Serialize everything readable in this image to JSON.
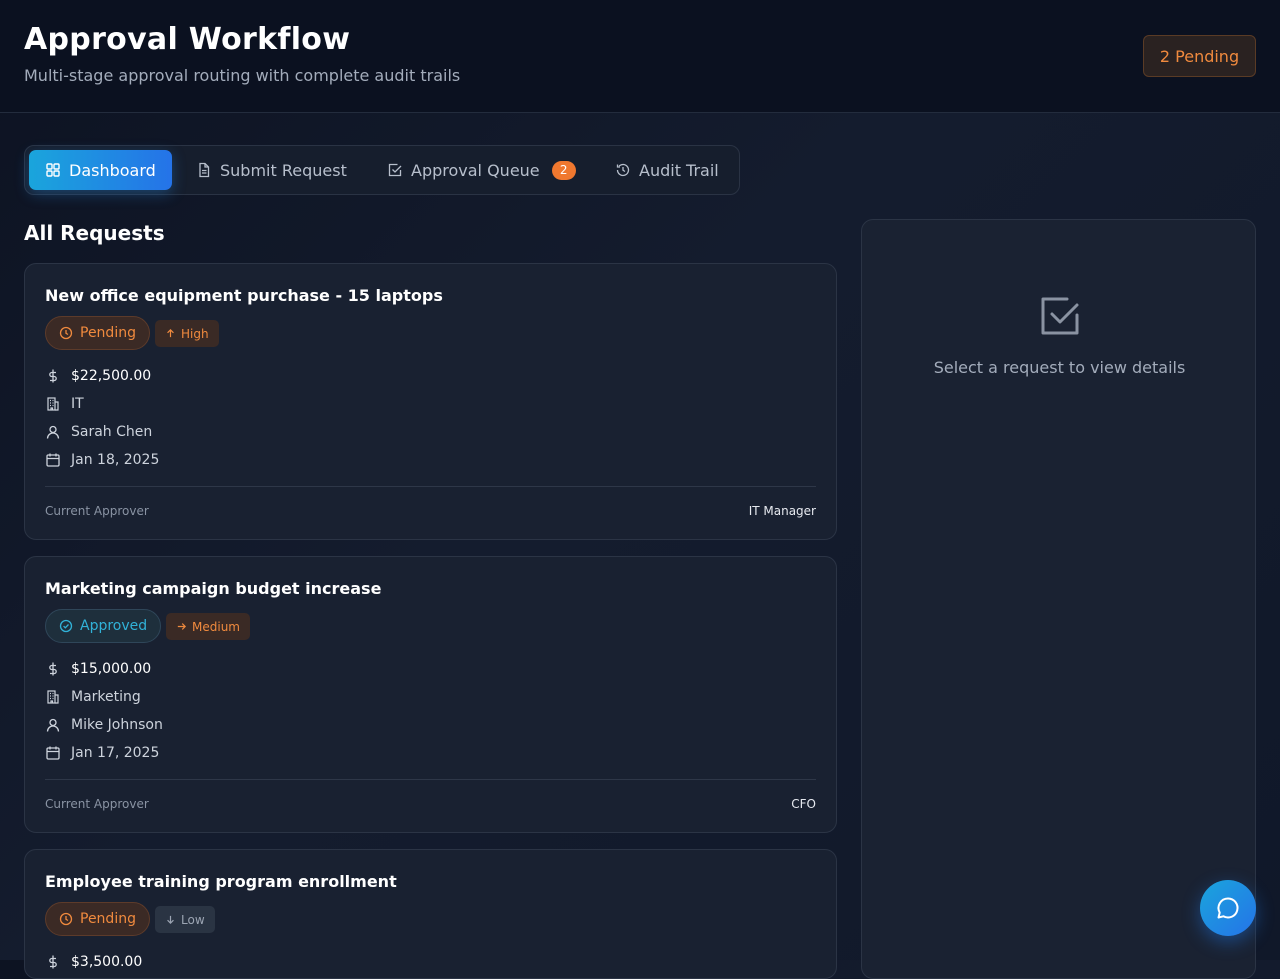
{
  "header": {
    "title": "Approval Workflow",
    "subtitle": "Multi-stage approval routing with complete audit trails",
    "pending_badge": "2 Pending"
  },
  "tabs": [
    {
      "label": "Dashboard",
      "icon": "dashboard-grid-icon",
      "active": true
    },
    {
      "label": "Submit Request",
      "icon": "document-icon",
      "active": false
    },
    {
      "label": "Approval Queue",
      "icon": "check-square-icon",
      "active": false,
      "count": "2"
    },
    {
      "label": "Audit Trail",
      "icon": "history-icon",
      "active": false
    }
  ],
  "main": {
    "section_title": "All Requests",
    "approver_label": "Current Approver"
  },
  "requests": [
    {
      "title": "New office equipment purchase - 15 laptops",
      "status": "Pending",
      "priority": "High",
      "amount": "$22,500.00",
      "department": "IT",
      "requester": "Sarah Chen",
      "date": "Jan 18, 2025",
      "approver": "IT Manager"
    },
    {
      "title": "Marketing campaign budget increase",
      "status": "Approved",
      "priority": "Medium",
      "amount": "$15,000.00",
      "department": "Marketing",
      "requester": "Mike Johnson",
      "date": "Jan 17, 2025",
      "approver": "CFO"
    },
    {
      "title": "Employee training program enrollment",
      "status": "Pending",
      "priority": "Low",
      "amount": "$3,500.00"
    }
  ],
  "detail": {
    "empty_text": "Select a request to view details",
    "icon": "check-square-icon"
  },
  "colors": {
    "accent_start": "#1aa5dc",
    "accent_end": "#2573e8",
    "pending": "#f08a3e",
    "approved": "#31b2d8"
  }
}
